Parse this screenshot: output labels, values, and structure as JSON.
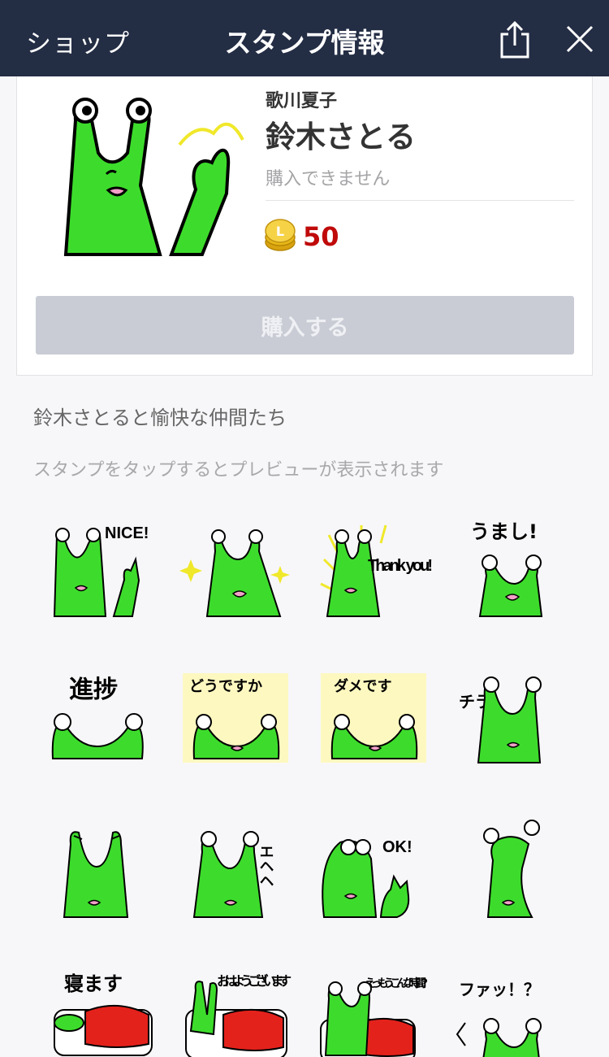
{
  "nav": {
    "back_label": "ショップ",
    "title": "スタンプ情報",
    "share_icon": "share-icon",
    "close_icon": "close-icon"
  },
  "product": {
    "author": "歌川夏子",
    "title": "鈴木さとる",
    "status": "購入できません",
    "price": "50",
    "coin_icon": "coin-icon",
    "buy_label": "購入する"
  },
  "description": "鈴木さとると愉快な仲間たち",
  "preview_hint": "スタンプをタップするとプレビューが表示されます",
  "stickers": [
    {
      "caption": "NICE!"
    },
    {
      "caption": ""
    },
    {
      "caption": "Thank you!"
    },
    {
      "caption": "うまし!"
    },
    {
      "caption": "進捗"
    },
    {
      "caption": "どうですか"
    },
    {
      "caption": "ダメです"
    },
    {
      "caption": "チラ"
    },
    {
      "caption": ""
    },
    {
      "caption": "エヘヘ"
    },
    {
      "caption": "OK!"
    },
    {
      "caption": ""
    },
    {
      "caption": "寝ます"
    },
    {
      "caption": "おはようございます"
    },
    {
      "caption": "えっもうこんな時間?"
    },
    {
      "caption": "ファッ！？"
    }
  ],
  "colors": {
    "navbar": "#232d44",
    "character_green": "#3ddc2c",
    "price_red": "#c00a0a",
    "button_disabled": "#c9ccd4"
  }
}
